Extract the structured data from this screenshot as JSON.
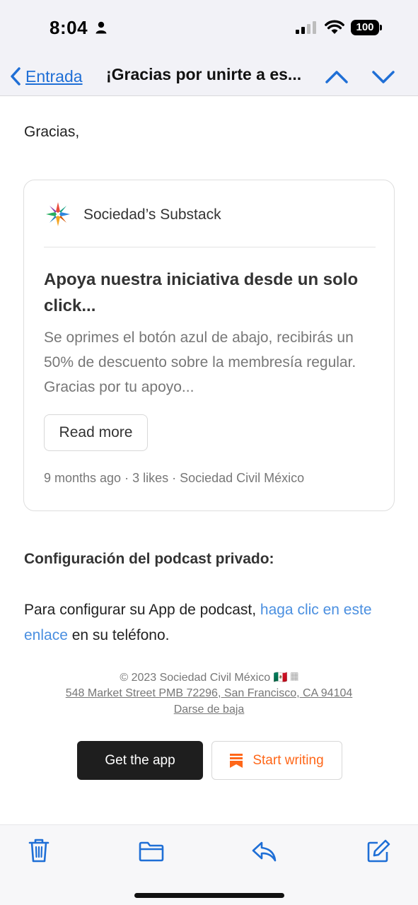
{
  "status_bar": {
    "time": "8:04",
    "battery": "100",
    "icons": [
      "person-icon",
      "signal-icon",
      "wifi-icon",
      "battery-icon"
    ]
  },
  "nav": {
    "back_label": "Entrada",
    "title": "¡Gracias por unirte a es...",
    "accent_color": "#1f6fd6"
  },
  "email": {
    "greeting": "Gracias,",
    "card": {
      "publication": "Sociedad’s Substack",
      "title": "Apoya nuestra iniciativa desde un solo click...",
      "excerpt": "Se oprimes el botón azul de abajo, recibirás un 50% de descuento sobre la membresía regular. Gracias por tu apoyo...",
      "read_more": "Read more",
      "meta": "9 months ago · 3 likes · Sociedad Civil México"
    },
    "podcast": {
      "heading": "Configuración del podcast privado:",
      "text_before": "Para configurar su App de podcast, ",
      "link_text": "haga clic en este enlace",
      "text_after": " en su teléfono."
    },
    "footer": {
      "copyright": "© 2023 Sociedad Civil México 🇲🇽 𝄜",
      "address": "548 Market Street PMB 72296, San Francisco, CA 94104",
      "unsubscribe": "Darse de baja"
    },
    "buttons": {
      "get_app": "Get the app",
      "start_writing": "Start writing",
      "brand_color": "#ff6719"
    }
  },
  "toolbar": {
    "icons": [
      "trash-icon",
      "folder-icon",
      "reply-icon",
      "compose-icon"
    ],
    "color": "#1f6fd6"
  }
}
